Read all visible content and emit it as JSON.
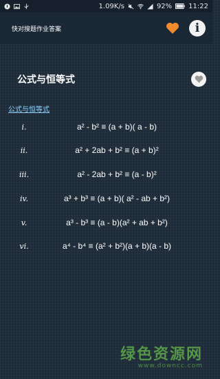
{
  "status_bar": {
    "speed": "1.09K/s",
    "battery": "92%",
    "time": "11:22"
  },
  "app_bar": {
    "title": "快对搜题作业答案",
    "favorite_icon": "heart-icon",
    "info_icon": "info-icon",
    "accent_color": "#f28a2e"
  },
  "section": {
    "title": "公式与恒等式",
    "link": "公式与恒等式"
  },
  "formulas": [
    {
      "roman": "i.",
      "text": "a² - b² ≡ (a + b)( a - b)"
    },
    {
      "roman": "ii.",
      "text": "a² + 2ab + b² ≡ (a + b)²"
    },
    {
      "roman": "iii.",
      "text": "a² - 2ab + b² ≡ (a - b)²"
    },
    {
      "roman": "iv.",
      "text": "a³ + b³ ≡ (a + b)( a² - ab + b²)"
    },
    {
      "roman": "v.",
      "text": "a³ - b³ ≡ (a - b)(a² + ab + b²)"
    },
    {
      "roman": "vi.",
      "text": "a⁴ - b⁴ ≡ (a² + b²)(a + b)(a - b)"
    }
  ],
  "watermark": {
    "text": "绿色资源网",
    "url": "www.downcc.com"
  }
}
